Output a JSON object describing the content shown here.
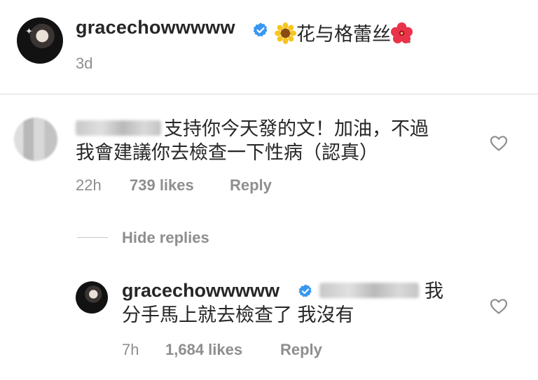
{
  "post": {
    "username": "gracechowwwww",
    "caption_emoji_left": "sunflower",
    "caption": "花与格蕾丝",
    "caption_emoji_right": "hibiscus",
    "time": "3d"
  },
  "comment": {
    "text_line1": "支持你今天發的文！加油，不過",
    "text_line2": "我會建議你去檢查一下性病（認真）",
    "time": "22h",
    "likes": "739 likes",
    "reply_label": "Reply"
  },
  "replies_toggle": {
    "label": "Hide replies"
  },
  "reply": {
    "username": "gracechowwwww",
    "text_line1": "我",
    "text_line2": "分手馬上就去檢查了 我沒有",
    "time": "7h",
    "likes": "1,684 likes",
    "reply_label": "Reply"
  },
  "icons": {
    "verified": "verified-badge-icon",
    "heart": "heart-outline-icon"
  },
  "colors": {
    "verified_blue": "#3897f0",
    "text": "#262626",
    "muted": "#8e8e8e",
    "divider": "#dbdbdb"
  }
}
